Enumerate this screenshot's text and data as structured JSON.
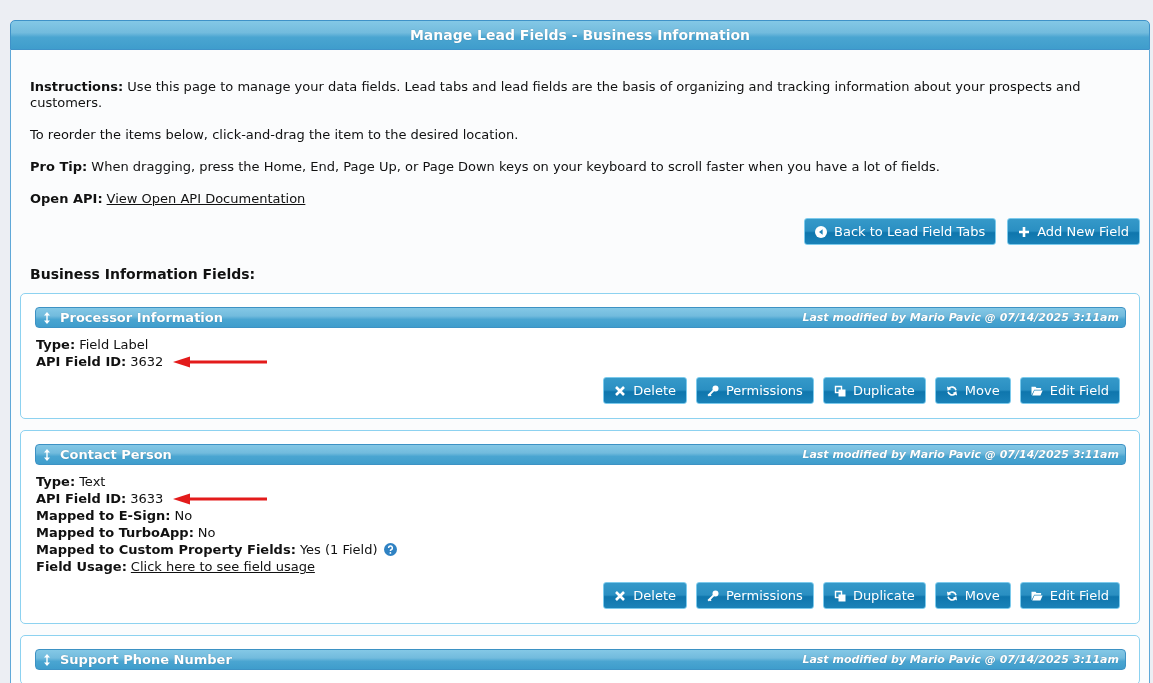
{
  "window": {
    "title": "Manage Lead Fields - Business Information"
  },
  "instructions": [
    "**Instructions:** Use this page to manage your data fields. Lead tabs and lead fields are the basis of organizing and tracking information about your prospects and customers.",
    "To reorder the items below, click-and-drag the item to the desired location.",
    "**Pro Tip:** When dragging, press the Home, End, Page Up, or Page Down keys on your keyboard to scroll faster when you have a lot of fields."
  ],
  "open_api": {
    "label": "Open API:",
    "link": "View Open API Documentation"
  },
  "actions": [
    {
      "kind": "back",
      "label": "Back to Lead Field Tabs"
    },
    {
      "kind": "add",
      "label": "Add New Field"
    }
  ],
  "section_title": "Business Information Fields:",
  "fields": [
    {
      "title": "Processor Information",
      "modified": "Last modified by Mario Pavic @ 07/14/2025 3:11am",
      "details": [
        {
          "kind": "text",
          "label": "Type:",
          "value": "Field Label",
          "marked": false
        },
        {
          "kind": "text",
          "label": "API Field ID:",
          "value": "3632",
          "marked": true
        }
      ],
      "buttons": [
        {
          "kind": "delete",
          "label": "Delete"
        },
        {
          "kind": "permissions",
          "label": "Permissions"
        },
        {
          "kind": "duplicate",
          "label": "Duplicate"
        },
        {
          "kind": "move",
          "label": "Move"
        },
        {
          "kind": "edit",
          "label": "Edit Field"
        }
      ]
    },
    {
      "title": "Contact Person",
      "modified": "Last modified by Mario Pavic @ 07/14/2025 3:11am",
      "details": [
        {
          "kind": "text",
          "label": "Type:",
          "value": "Text",
          "marked": false
        },
        {
          "kind": "text",
          "label": "API Field ID:",
          "value": "3633",
          "marked": true
        },
        {
          "kind": "text",
          "label": "Mapped to E-Sign:",
          "value": "No",
          "marked": false
        },
        {
          "kind": "text",
          "label": "Mapped to TurboApp:",
          "value": "No",
          "marked": false
        },
        {
          "kind": "help",
          "label": "Mapped to Custom Property Fields:",
          "value": "Yes (1 Field)",
          "marked": false
        },
        {
          "kind": "link",
          "label": "Field Usage:",
          "value": "Click here to see field usage",
          "marked": false
        }
      ],
      "buttons": [
        {
          "kind": "delete",
          "label": "Delete"
        },
        {
          "kind": "permissions",
          "label": "Permissions"
        },
        {
          "kind": "duplicate",
          "label": "Duplicate"
        },
        {
          "kind": "move",
          "label": "Move"
        },
        {
          "kind": "edit",
          "label": "Edit Field"
        }
      ]
    },
    {
      "title": "Support Phone Number",
      "modified": "Last modified by Mario Pavic @ 07/14/2025 3:11am"
    }
  ]
}
